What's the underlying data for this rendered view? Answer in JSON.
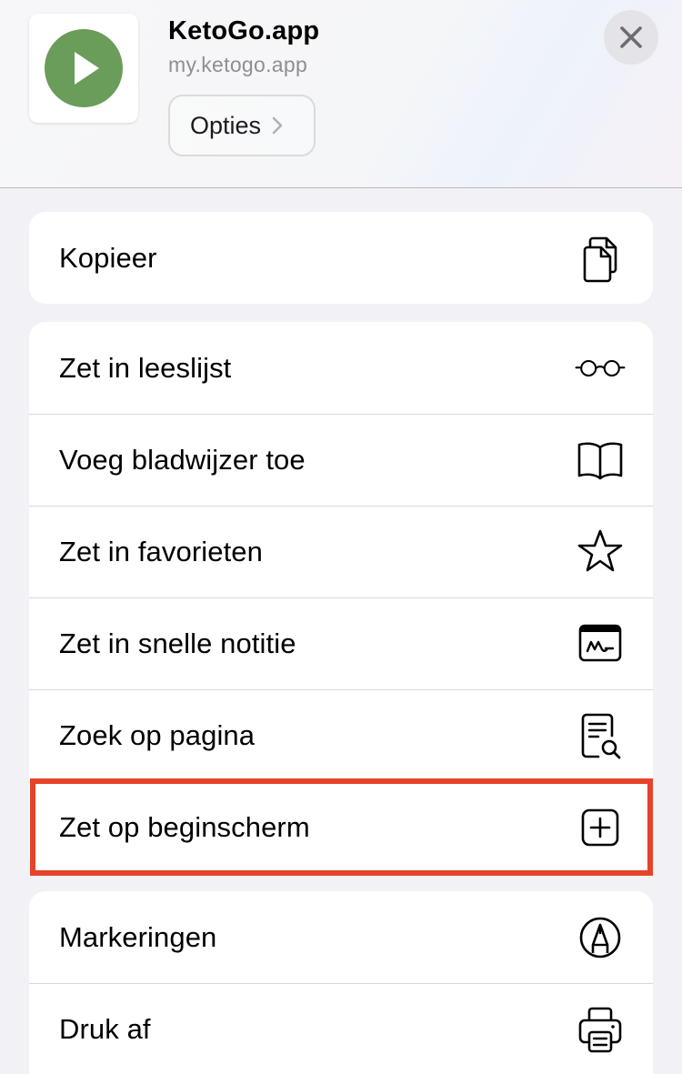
{
  "header": {
    "app_name": "KetoGo.app",
    "app_url": "my.ketogo.app",
    "options_label": "Opties",
    "app_icon": "play-icon",
    "app_icon_color": "#6a9c5a",
    "close_icon": "close-icon"
  },
  "groups": [
    {
      "items": [
        {
          "label": "Kopieer",
          "icon": "copy-icon"
        }
      ]
    },
    {
      "items": [
        {
          "label": "Zet in leeslijst",
          "icon": "glasses-icon"
        },
        {
          "label": "Voeg bladwijzer toe",
          "icon": "book-icon"
        },
        {
          "label": "Zet in favorieten",
          "icon": "star-icon"
        },
        {
          "label": "Zet in snelle notitie",
          "icon": "quick-note-icon"
        },
        {
          "label": "Zoek op pagina",
          "icon": "find-on-page-icon"
        },
        {
          "label": "Zet op beginscherm",
          "icon": "add-square-icon",
          "highlighted": true
        }
      ]
    },
    {
      "items": [
        {
          "label": "Markeringen",
          "icon": "markup-icon"
        },
        {
          "label": "Druk af",
          "icon": "printer-icon"
        }
      ]
    }
  ],
  "highlight_color": "#e5432a"
}
